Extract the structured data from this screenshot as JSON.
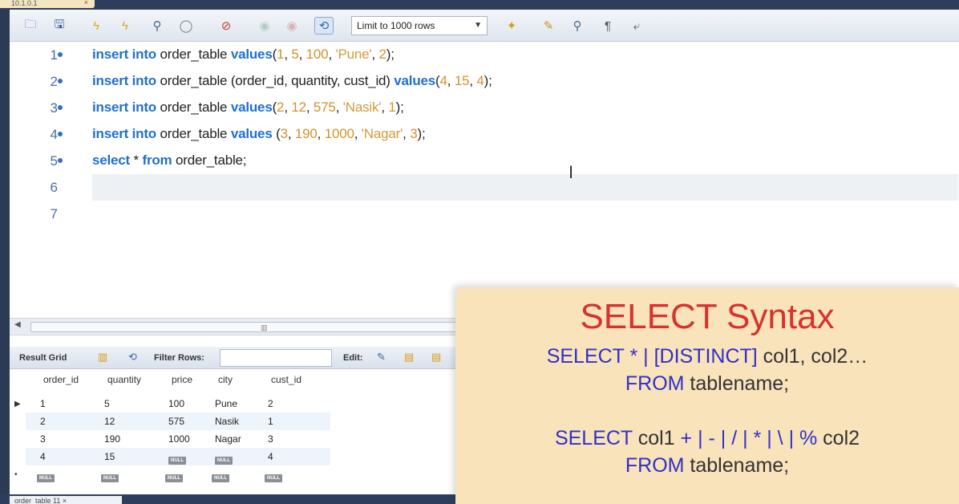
{
  "tab": {
    "title": "10.1.0.1",
    "close": "×"
  },
  "toolbar": {
    "limit_select": "Limit to 1000 rows",
    "limit_arrow": "▼",
    "icons": [
      "folder-icon",
      "save-icon",
      "lightning-icon",
      "lightning-cursor-icon",
      "magnifier-icon",
      "stop-icon",
      "toggle-icon",
      "commit-icon",
      "rollback-icon",
      "autocommit-icon",
      "beautify-icon",
      "find-icon",
      "invisible-chars-icon",
      "wrap-icon"
    ]
  },
  "editor": {
    "lines": [
      {
        "num": "1",
        "marker": true
      },
      {
        "num": "2",
        "marker": true
      },
      {
        "num": "3",
        "marker": true
      },
      {
        "num": "4",
        "marker": true
      },
      {
        "num": "5",
        "marker": true
      },
      {
        "num": "6",
        "marker": false
      },
      {
        "num": "7",
        "marker": false
      }
    ],
    "code": {
      "l1": {
        "kw1": "insert into",
        "t1": " order_table ",
        "kw2": "values",
        "t2": "(",
        "n1": "1",
        "c1": ", ",
        "n2": "5",
        "c2": ", ",
        "n3": "100",
        "c3": ", ",
        "s1": "'Pune'",
        "c4": ", ",
        "n4": "2",
        "end": ");"
      },
      "l2": {
        "kw1": "insert into",
        "t1": " order_table (order_id, quantity, cust_id) ",
        "kw2": "values",
        "t2": "(",
        "n1": "4",
        "c1": ", ",
        "n2": "15",
        "c2": ", ",
        "n3": "4",
        "end": ");"
      },
      "l3": {
        "kw1": "insert into",
        "t1": " order_table ",
        "kw2": "values",
        "t2": "(",
        "n1": "2",
        "c1": ", ",
        "n2": "12",
        "c2": ", ",
        "n3": "575",
        "c3": ", ",
        "s1": "'Nasik'",
        "c4": ", ",
        "n4": "1",
        "end": ");"
      },
      "l4": {
        "kw1": "insert into",
        "t1": " order_table ",
        "kw2": "values",
        "t2": " (",
        "n1": "3",
        "c1": ", ",
        "n2": "190",
        "c2": ", ",
        "n3": "1000",
        "c3": ", ",
        "s1": "'Nagar'",
        "c4": ", ",
        "n4": "3",
        "end": ");"
      },
      "l5": {
        "kw1": "select",
        "t1": " * ",
        "kw2": "from",
        "t2": " order_table;"
      }
    }
  },
  "results": {
    "result_grid_label": "Result Grid",
    "filter_label": "Filter Rows:",
    "edit_label": "Edit:",
    "columns": [
      "order_id",
      "quantity",
      "price",
      "city",
      "cust_id"
    ],
    "rows": [
      [
        "1",
        "5",
        "100",
        "Pune",
        "2"
      ],
      [
        "2",
        "12",
        "575",
        "Nasik",
        "1"
      ],
      [
        "3",
        "190",
        "1000",
        "Nagar",
        "3"
      ],
      [
        "4",
        "15",
        "NULL",
        "NULL",
        "4"
      ],
      [
        "NULL",
        "NULL",
        "NULL",
        "NULL",
        "NULL"
      ]
    ],
    "null_text": "NULL"
  },
  "bottom_tab": {
    "title": "order_table 11 ×"
  },
  "card": {
    "title": "SELECT Syntax",
    "l1_kw": "SELECT * | [DISTINCT]",
    "l1_rest": " col1, col2…",
    "l2_kw": "FROM",
    "l2_rest": " tablename;",
    "l3_kw": "SELECT",
    "l3_a": " col1 ",
    "l3_ops": "+ | - | / | * | \\ | %",
    "l3_b": " col2",
    "l4_kw": "FROM",
    "l4_rest": " tablename;"
  }
}
